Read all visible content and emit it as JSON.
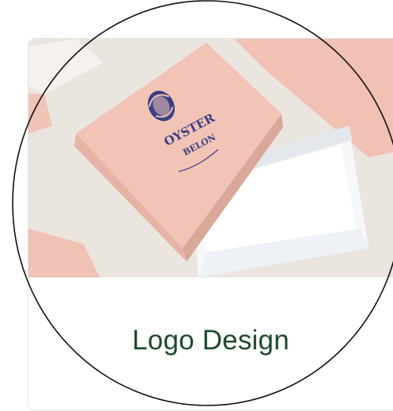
{
  "card": {
    "title": "Logo Design",
    "image_alt": "Pink gift box packaging with OYSTER BELON logo",
    "brand_line1": "OYSTER",
    "brand_line2": "BELON",
    "icons": [
      "oyster-icon"
    ]
  },
  "colors": {
    "title_text": "#1f4a2a",
    "box_pink": "#f2c4b6",
    "logo_ink": "#3a3f86",
    "card_border": "#dfe6dc"
  }
}
